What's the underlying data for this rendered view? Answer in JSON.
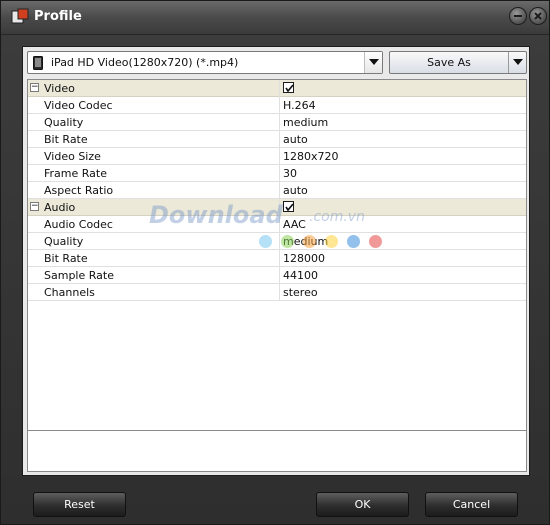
{
  "window": {
    "title": "Profile"
  },
  "profile_select": {
    "value": "iPad HD Video(1280x720) (*.mp4)"
  },
  "save_as": {
    "label": "Save As"
  },
  "video_section": {
    "label": "Video",
    "enabled": true,
    "rows": [
      {
        "name": "Video Codec",
        "value": "H.264"
      },
      {
        "name": "Quality",
        "value": "medium"
      },
      {
        "name": "Bit Rate",
        "value": "auto"
      },
      {
        "name": "Video Size",
        "value": "1280x720"
      },
      {
        "name": "Frame Rate",
        "value": "30"
      },
      {
        "name": "Aspect Ratio",
        "value": "auto"
      }
    ]
  },
  "audio_section": {
    "label": "Audio",
    "enabled": true,
    "rows": [
      {
        "name": "Audio Codec",
        "value": "AAC"
      },
      {
        "name": "Quality",
        "value": "medium"
      },
      {
        "name": "Bit Rate",
        "value": "128000"
      },
      {
        "name": "Sample Rate",
        "value": "44100"
      },
      {
        "name": "Channels",
        "value": "stereo"
      }
    ]
  },
  "footer": {
    "reset_label": "Reset",
    "ok_label": "OK",
    "cancel_label": "Cancel"
  },
  "watermark": {
    "brand": "Download",
    "domain": ".com.vn"
  },
  "colors": {
    "section_bg": "#ece9d8",
    "window_bg": "#3a3a3a"
  }
}
